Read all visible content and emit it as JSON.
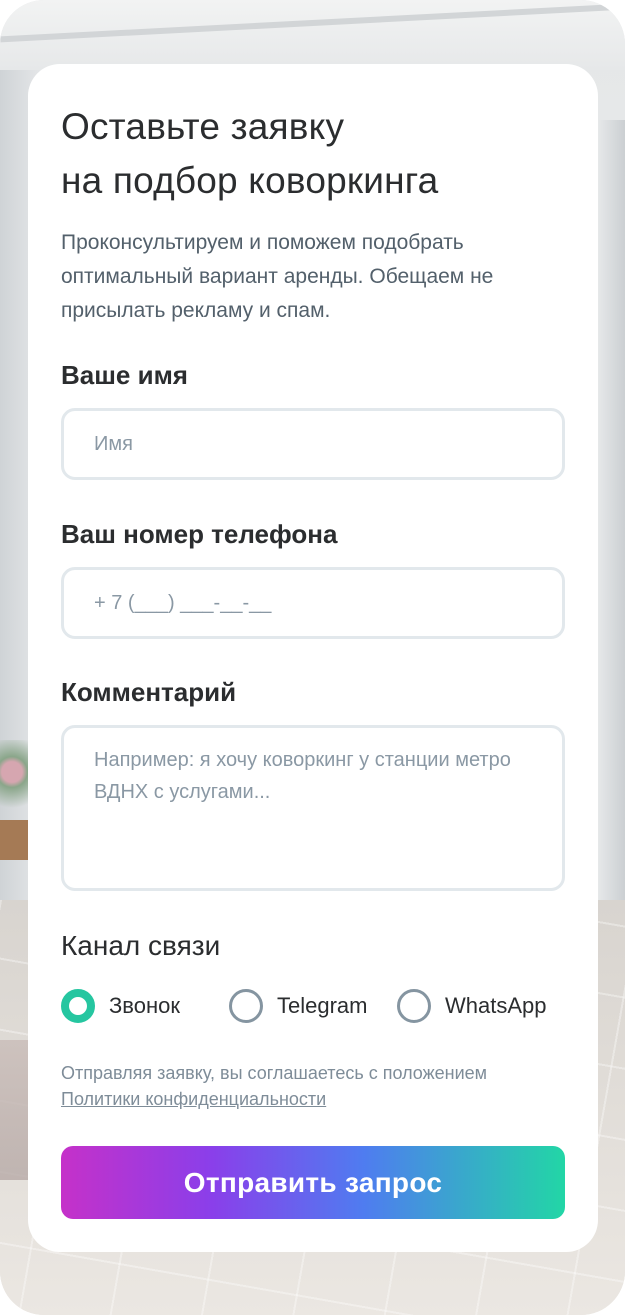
{
  "form": {
    "title_line1": "Оставьте заявку",
    "title_line2": "на подбор коворкинга",
    "subtitle": "Проконсультируем и поможем подобрать оптимальный вариант аренды. Обещаем не присылать рекламу и спам.",
    "name_label": "Ваше имя",
    "name_placeholder": "Имя",
    "name_value": "",
    "phone_label": "Ваш номер телефона",
    "phone_placeholder": "+ 7 (___) ___-__-__",
    "phone_value": "",
    "comment_label": "Комментарий",
    "comment_placeholder": "Например: я хочу коворкинг у станции метро ВДНХ с услугами...",
    "comment_value": "",
    "channel_label": "Канал связи",
    "channels": [
      {
        "label": "Звонок",
        "selected": true
      },
      {
        "label": "Telegram",
        "selected": false
      },
      {
        "label": "WhatsApp",
        "selected": false
      }
    ],
    "consent_text": "Отправляя заявку, вы соглашаетесь с положением",
    "consent_link": "Политики конфиденциальности",
    "submit_label": "Отправить запрос"
  },
  "colors": {
    "accent_radio": "#25c6a0",
    "button_gradient_start": "#c531c9",
    "button_gradient_end": "#22d6a6",
    "text_primary": "#2b2d2f",
    "text_muted": "#7e8c98"
  }
}
